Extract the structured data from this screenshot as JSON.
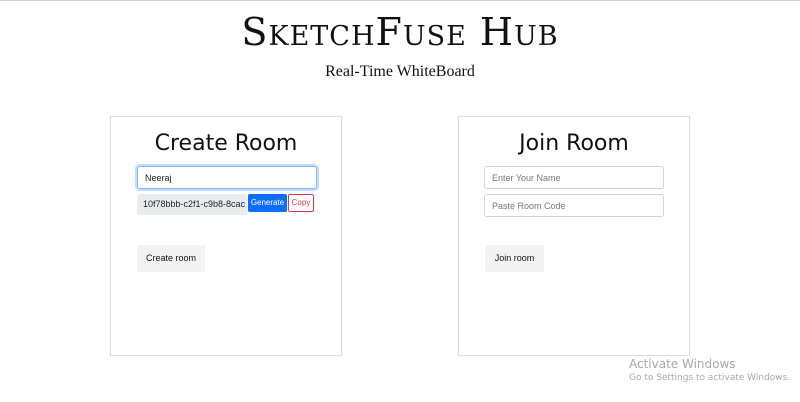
{
  "header": {
    "title": "SketchFuse Hub",
    "subtitle": "Real-Time WhiteBoard"
  },
  "create_room": {
    "title": "Create Room",
    "name_value": "Neeraj",
    "room_code": "10f78bbb-c2f1-c9b8-8cac",
    "generate_label": "Generate",
    "copy_label": "Copy",
    "button_label": "Create room"
  },
  "join_room": {
    "title": "Join Room",
    "name_placeholder": "Enter Your Name",
    "code_placeholder": "Paste Room Code",
    "button_label": "Join room"
  },
  "watermark": {
    "line1": "Activate Windows",
    "line2": "Go to Settings to activate Windows."
  },
  "colors": {
    "primary": "#0d6efd",
    "danger": "#dc3545",
    "focus": "#86b7fe"
  }
}
